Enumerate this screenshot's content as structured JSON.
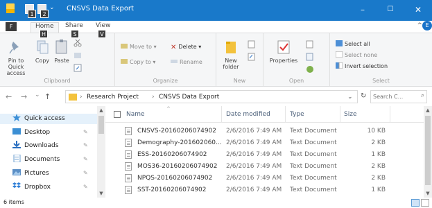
{
  "window": {
    "title": "CNSVS Data Export",
    "qat_keytips": [
      "1",
      "2"
    ],
    "minimize": "–",
    "maximize": "☐",
    "close": "✕"
  },
  "ribbon": {
    "file_tab": "F",
    "tabs": [
      {
        "label": "Home",
        "keytip": "H"
      },
      {
        "label": "Share",
        "keytip": "S"
      },
      {
        "label": "View",
        "keytip": "V"
      }
    ],
    "collapse": "^",
    "help_keytip": "E",
    "clipboard": {
      "label": "Clipboard",
      "pin": "Pin to Quick access",
      "copy": "Copy",
      "paste": "Paste"
    },
    "organize": {
      "label": "Organize",
      "move_to": "Move to ▾",
      "delete": "Delete ▾",
      "copy_to": "Copy to ▾",
      "rename": "Rename"
    },
    "new": {
      "label": "New",
      "new_folder": "New folder"
    },
    "open": {
      "label": "Open",
      "properties": "Properties"
    },
    "select": {
      "label": "Select",
      "select_all": "Select all",
      "select_none": "Select none",
      "invert": "Invert selection"
    }
  },
  "address": {
    "back": "←",
    "forward": "→",
    "recent": "⌄",
    "up": "↑",
    "crumbs": [
      "Research Project",
      "CNSVS Data Export"
    ],
    "separator": "›",
    "dropdown": "⌄",
    "refresh": "↻",
    "search_placeholder": "Search C...",
    "search_icon": "⌕"
  },
  "nav": {
    "items": [
      {
        "label": "Quick access",
        "icon": "star-icon",
        "color": "#3c8fd6"
      },
      {
        "label": "Desktop",
        "icon": "desktop-icon",
        "color": "#3b8fd4"
      },
      {
        "label": "Downloads",
        "icon": "download-icon",
        "color": "#2a6fc0"
      },
      {
        "label": "Documents",
        "icon": "documents-icon",
        "color": "#6a9ccf"
      },
      {
        "label": "Pictures",
        "icon": "pictures-icon",
        "color": "#5b8fc6"
      },
      {
        "label": "Dropbox",
        "icon": "dropbox-icon",
        "color": "#2d7ed6"
      }
    ],
    "pin_glyph": "📌"
  },
  "list": {
    "headers": {
      "name": "Name",
      "date": "Date modified",
      "type": "Type",
      "size": "Size"
    },
    "rows": [
      {
        "name": "CNSVS-20160206074902",
        "date": "2/6/2016 7:49 AM",
        "type": "Text Document",
        "size": "10 KB"
      },
      {
        "name": "Demography-201602060...",
        "date": "2/6/2016 7:49 AM",
        "type": "Text Document",
        "size": "2 KB"
      },
      {
        "name": "ESS-20160206074902",
        "date": "2/6/2016 7:49 AM",
        "type": "Text Document",
        "size": "1 KB"
      },
      {
        "name": "MOS36-20160206074902",
        "date": "2/6/2016 7:49 AM",
        "type": "Text Document",
        "size": "2 KB"
      },
      {
        "name": "NPQS-20160206074902",
        "date": "2/6/2016 7:49 AM",
        "type": "Text Document",
        "size": "2 KB"
      },
      {
        "name": "SST-20160206074902",
        "date": "2/6/2016 7:49 AM",
        "type": "Text Document",
        "size": "1 KB"
      }
    ]
  },
  "status": {
    "count": "6 items"
  },
  "colors": {
    "titlebar": "#1979ca",
    "accent": "#0078d7"
  }
}
